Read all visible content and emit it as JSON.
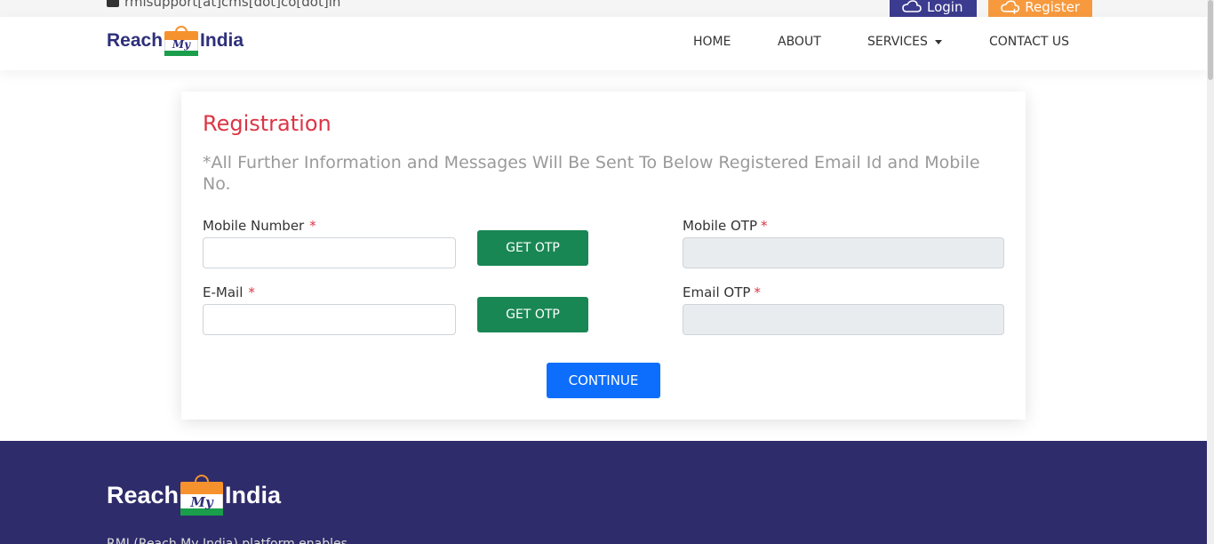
{
  "topbar": {
    "email": "rmisupport[at]cms[dot]co[dot]in",
    "login_label": "Login",
    "register_label": "Register"
  },
  "brand": {
    "left_word": "Reach",
    "middle_word": "My",
    "right_word": "India"
  },
  "nav": {
    "home": "HOME",
    "about": "ABOUT",
    "services": "SERVICES",
    "contact": "CONTACT US"
  },
  "form": {
    "title": "Registration",
    "note": "*All Further Information and Messages Will Be Sent To Below Registered Email Id and Mobile No.",
    "mobile_label": "Mobile Number",
    "email_label": "E-Mail",
    "mobile_otp_label": "Mobile OTP",
    "email_otp_label": "Email OTP",
    "required_mark": "*",
    "get_otp_label": "GET OTP",
    "continue_label": "CONTINUE",
    "mobile_value": "",
    "email_value": "",
    "mobile_otp_value": "",
    "email_otp_value": ""
  },
  "footer": {
    "description": "RMI (Reach My India) platform enables"
  },
  "colors": {
    "brand_navy": "#2e2f7a",
    "brand_orange": "#f6922e",
    "brand_green": "#1a9e4b",
    "title_red": "#dc3545",
    "otp_green": "#198754",
    "continue_blue": "#0d6efd",
    "footer_bg": "#2e2c6b"
  },
  "icons": {
    "email": "envelope-icon",
    "login": "cloud-lock-icon",
    "register": "cloud-plus-icon",
    "services_dropdown": "caret-down-icon"
  }
}
